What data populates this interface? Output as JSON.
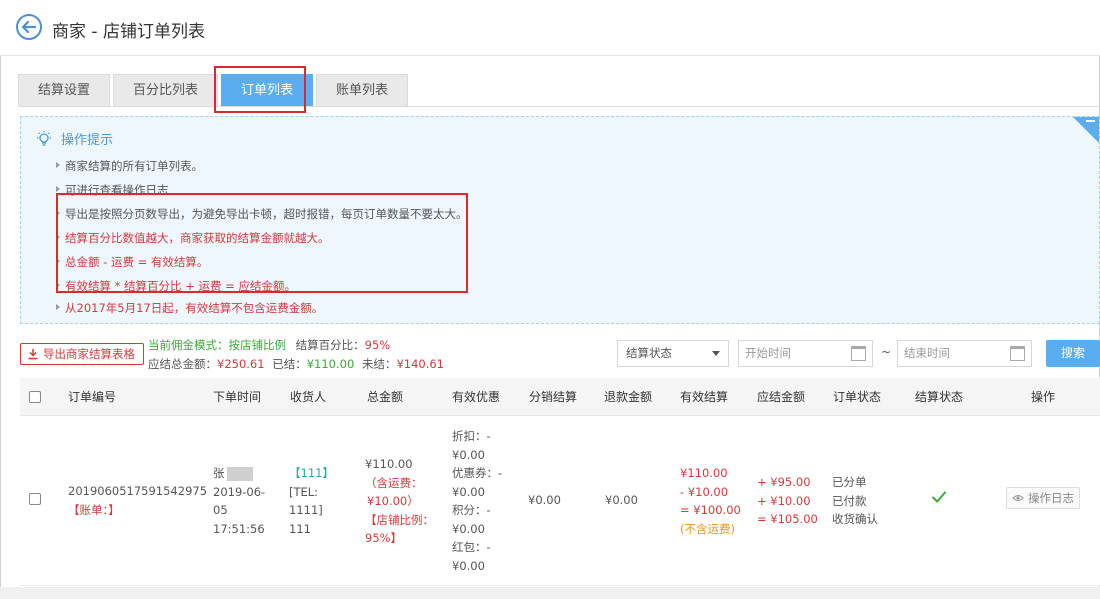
{
  "header": {
    "title": "商家 - 店铺订单列表",
    "back_icon": "back-arrow-icon"
  },
  "tabs": [
    {
      "label": "结算设置",
      "active": false
    },
    {
      "label": "百分比列表",
      "active": false
    },
    {
      "label": "订单列表",
      "active": true
    },
    {
      "label": "账单列表",
      "active": false
    }
  ],
  "tips": {
    "title": "操作提示",
    "items": [
      "商家结算的所有订单列表。",
      "可进行查看操作日志",
      "导出是按照分页数导出，为避免导出卡顿，超时报错，每页订单数量不要太大。",
      "结算百分比数值越大，商家获取的结算金额就越大。",
      "总金额 - 运费 = 有效结算。",
      "有效结算 * 结算百分比 + 运费 = 应结金额。",
      "从2017年5月17日起，有效结算不包含运费金额。"
    ]
  },
  "toolbar": {
    "export_label": "导出商家结算表格",
    "mode_label": "当前佣金模式：按店铺比例",
    "percent_label": "结算百分比：",
    "percent_value": "95%",
    "total_label": "应结总金额：",
    "total_value": "¥250.61",
    "settled_label": "已结：",
    "settled_value": "¥110.00",
    "unsettled_label": "未结：",
    "unsettled_value": "¥140.61",
    "status_select": "结算状态",
    "start_placeholder": "开始时间",
    "tilde": "~",
    "end_placeholder": "结束时间",
    "search_label": "搜索"
  },
  "table": {
    "headers": [
      "订单编号",
      "下单时间",
      "收货人",
      "总金额",
      "有效优惠",
      "分销结算",
      "退款金额",
      "有效结算",
      "应结金额",
      "订单状态",
      "结算状态",
      "操作"
    ],
    "rows": [
      {
        "order_no": "2019060517591542975",
        "bill": "【账单：】",
        "time_name": "张",
        "time_lines": [
          "2019-06-",
          "05",
          "17:51:56"
        ],
        "receiver_lines": [
          "【111】",
          "[TEL:",
          "1111]",
          "111"
        ],
        "total_lines": [
          "¥110.00",
          "（含运费：",
          "¥10.00）",
          "【店铺比例：",
          "95%】"
        ],
        "discount_lines": [
          "折扣：-",
          "¥0.00",
          "优惠券：-",
          "¥0.00",
          "积分：-",
          "¥0.00",
          "红包：-",
          "¥0.00"
        ],
        "distribution": "¥0.00",
        "refund": "¥0.00",
        "effective_lines": [
          "¥110.00",
          "- ¥10.00",
          "= ¥100.00",
          "(不含运费)"
        ],
        "payable_lines": [
          "+ ¥95.00",
          "+ ¥10.00",
          "= ¥105.00"
        ],
        "status_lines": [
          "已分单",
          "已付款",
          "收货确认"
        ],
        "settle_icon": "check-icon",
        "action_label": "操作日志"
      }
    ]
  }
}
